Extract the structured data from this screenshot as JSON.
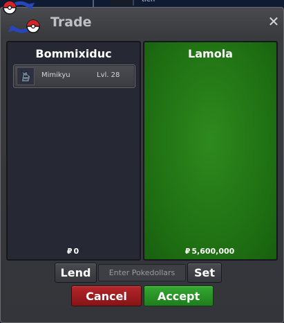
{
  "background": {
    "text": "tien"
  },
  "window": {
    "title": "Trade",
    "close_label": "✕"
  },
  "left_panel": {
    "player_name": "Bommixiduc",
    "money": "0",
    "currency_symbol": "₽",
    "items": [
      {
        "name": "Mimikyu",
        "level": "Lvl. 28",
        "icon": "mimikyu-sprite-icon"
      }
    ]
  },
  "right_panel": {
    "player_name": "Lamola",
    "money": "5,600,000",
    "currency_symbol": "₽",
    "accent_color": "#2a8a1c"
  },
  "controls": {
    "lend_label": "Lend",
    "money_placeholder": "Enter Pokedollars",
    "set_label": "Set",
    "cancel_label": "Cancel",
    "accept_label": "Accept"
  },
  "colors": {
    "cancel": "#a11f22",
    "accept": "#2a9227",
    "panel_dark": "#262834"
  }
}
